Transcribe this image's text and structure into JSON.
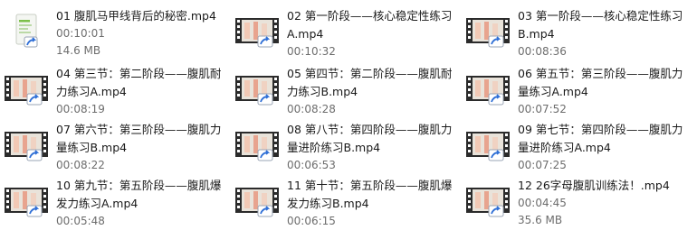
{
  "files": [
    {
      "name": "01 腹肌马甲线背后的秘密.mp4",
      "duration": "00:10:01",
      "size": "14.6 MB",
      "icon": "document-file-icon"
    },
    {
      "name": "02 第一阶段——核心稳定性练习A.mp4",
      "duration": "00:10:32",
      "size": "",
      "icon": "video-file-icon"
    },
    {
      "name": "03 第一阶段——核心稳定性练习B.mp4",
      "duration": "00:08:36",
      "size": "",
      "icon": "video-file-icon"
    },
    {
      "name": "04 第三节：第二阶段——腹肌耐力练习A.mp4",
      "duration": "00:08:19",
      "size": "",
      "icon": "video-file-icon"
    },
    {
      "name": "05 第四节：第二阶段——腹肌耐力练习B.mp4",
      "duration": "00:08:28",
      "size": "",
      "icon": "video-file-icon"
    },
    {
      "name": "06 第五节：第三阶段——腹肌力量练习A.mp4",
      "duration": "00:07:52",
      "size": "",
      "icon": "video-file-icon"
    },
    {
      "name": "07 第六节：第三阶段——腹肌力量练习B.mp4",
      "duration": "00:08:22",
      "size": "",
      "icon": "video-file-icon"
    },
    {
      "name": "08 第八节：第四阶段——腹肌力量进阶练习B.mp4",
      "duration": "00:06:53",
      "size": "",
      "icon": "video-file-icon"
    },
    {
      "name": "09 第七节：第四阶段——腹肌力量进阶练习A.mp4",
      "duration": "00:07:25",
      "size": "",
      "icon": "video-file-icon"
    },
    {
      "name": "10 第九节：第五阶段——腹肌爆发力练习A.mp4",
      "duration": "00:05:48",
      "size": "",
      "icon": "video-file-icon"
    },
    {
      "name": "11 第十节：第五阶段——腹肌爆发力练习B.mp4",
      "duration": "00:06:15",
      "size": "",
      "icon": "video-file-icon"
    },
    {
      "name": "12 26字母腹肌训练法！.mp4",
      "duration": "00:04:45",
      "size": "35.6 MB",
      "icon": "video-file-icon"
    }
  ],
  "colors": {
    "filmstrip": "#2b2b2b",
    "shortcut_arrow": "#2f6fd6",
    "doc_green": "#7cc04a"
  }
}
